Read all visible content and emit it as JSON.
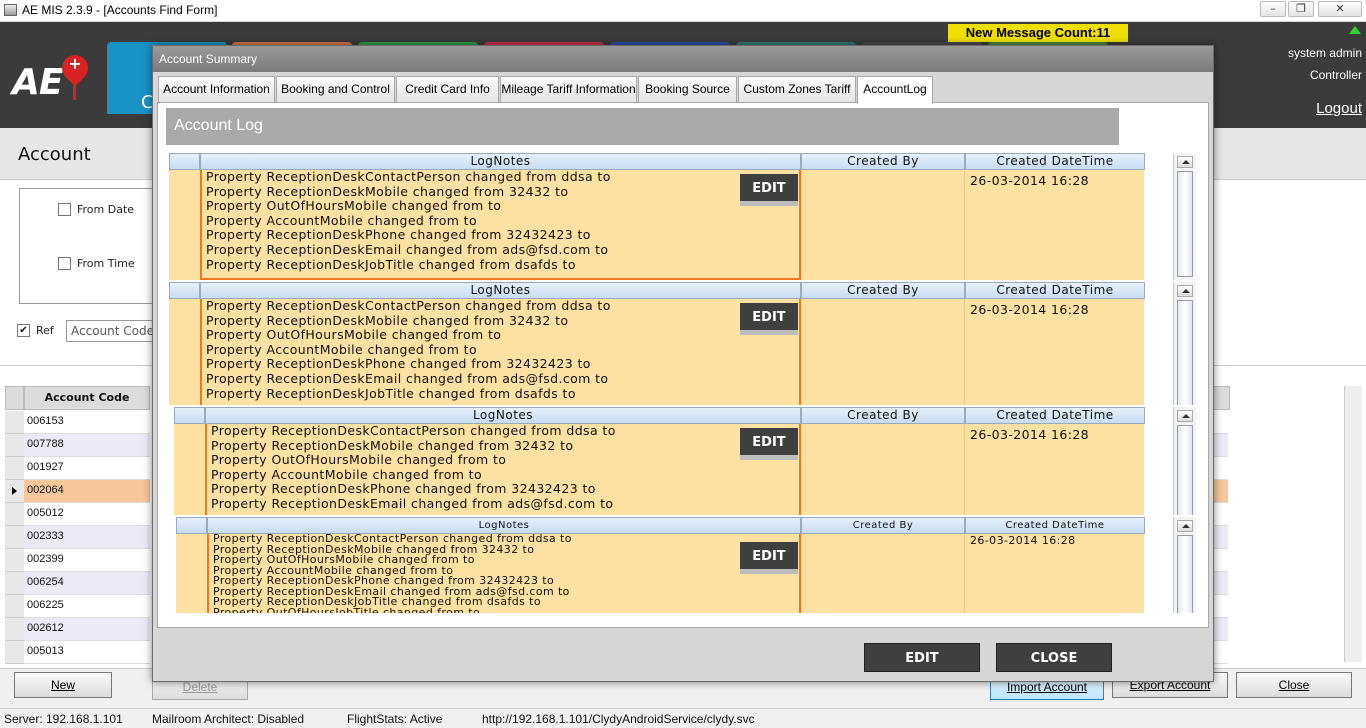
{
  "window": {
    "title": "AE MIS 2.3.9 - [Accounts Find Form]",
    "minimize": "–",
    "restore": "❐",
    "close": "✕"
  },
  "header": {
    "logo_text": "AE",
    "logo_mark": "+",
    "message_count": "New Message Count:11",
    "user_name": "system admin",
    "user_role": "Controller",
    "logout": "Logout",
    "nav_tile_colors": [
      "#1a94c6",
      "#d9774a",
      "#2f9c4a",
      "#c8314a",
      "#2d4fa8",
      "#2f7b74",
      "#4a4a4a",
      "#4e8a3e"
    ],
    "nav_tile_letter": "C"
  },
  "page": {
    "title": "Account",
    "filters": {
      "from_date": "From Date",
      "from_time": "From Time",
      "ref": "Ref",
      "account_code_placeholder": "Account Code"
    },
    "grid": {
      "header": "Account Code",
      "rows": [
        "006153",
        "007788",
        "001927",
        "002064",
        "005012",
        "002333",
        "002399",
        "006254",
        "006225",
        "002612",
        "005013"
      ],
      "selected_index": 3
    },
    "buttons": {
      "new": "New",
      "delete": "Delete",
      "import": "Import Account",
      "export": "Export Account",
      "close": "Close"
    }
  },
  "status": {
    "server": "Server: 192.168.1.101",
    "mailroom": "Mailroom Architect: Disabled",
    "flightstats": "FlightStats: Active",
    "url": "http://192.168.1.101/ClydyAndroidService/clydy.svc"
  },
  "dialog": {
    "title": "Account Summary",
    "tabs": [
      "Account Information",
      "Booking and Control",
      "Credit Card Info",
      "Mileage Tariff Information",
      "Booking Source",
      "Custom Zones Tariff",
      "AccountLog"
    ],
    "active_tab": 6,
    "section_title": "Account Log",
    "columns": {
      "notes": "LogNotes",
      "created_by": "Created By",
      "created_datetime": "Created DateTime"
    },
    "entries": [
      {
        "notes": [
          "Property ReceptionDeskContactPerson changed from ddsa to",
          "Property ReceptionDeskMobile changed from 32432 to",
          "Property OutOfHoursMobile changed from  to",
          "Property AccountMobile changed from  to",
          "Property ReceptionDeskPhone changed from 32432423 to",
          "Property ReceptionDeskEmail changed from ads@fsd.com to",
          "Property ReceptionDeskJobTitle changed from dsafds to"
        ],
        "created_by": "",
        "datetime": "26-03-2014 16:28",
        "edit_label": "EDIT"
      },
      {
        "notes": [
          "Property ReceptionDeskContactPerson changed from ddsa to",
          "Property ReceptionDeskMobile changed from 32432 to",
          "Property OutOfHoursMobile changed from  to",
          "Property AccountMobile changed from  to",
          "Property ReceptionDeskPhone changed from 32432423 to",
          "Property ReceptionDeskEmail changed from ads@fsd.com to",
          "Property ReceptionDeskJobTitle changed from dsafds to"
        ],
        "created_by": "",
        "datetime": "26-03-2014 16:28",
        "edit_label": "EDIT"
      },
      {
        "notes": [
          "Property ReceptionDeskContactPerson changed from ddsa to",
          "Property ReceptionDeskMobile changed from 32432 to",
          "Property OutOfHoursMobile changed from  to",
          "Property AccountMobile changed from  to",
          "Property ReceptionDeskPhone changed from 32432423 to",
          "Property ReceptionDeskEmail changed from ads@fsd.com to"
        ],
        "created_by": "",
        "datetime": "26-03-2014 16:28",
        "edit_label": "EDIT"
      },
      {
        "notes": [
          "Property ReceptionDeskContactPerson changed from ddsa to",
          "Property ReceptionDeskMobile changed from 32432 to",
          "Property OutOfHoursMobile changed from  to",
          "Property AccountMobile changed from  to",
          "Property ReceptionDeskPhone changed from 32432423 to",
          "Property ReceptionDeskEmail changed from ads@fsd.com to",
          "Property ReceptionDeskJobTitle changed from dsafds to",
          "Property OutOfHoursJobTitle changed from  to"
        ],
        "created_by": "",
        "datetime": "26-03-2014 16:28",
        "edit_label": "EDIT"
      }
    ],
    "footer_buttons": {
      "edit": "EDIT",
      "close": "CLOSE"
    }
  }
}
